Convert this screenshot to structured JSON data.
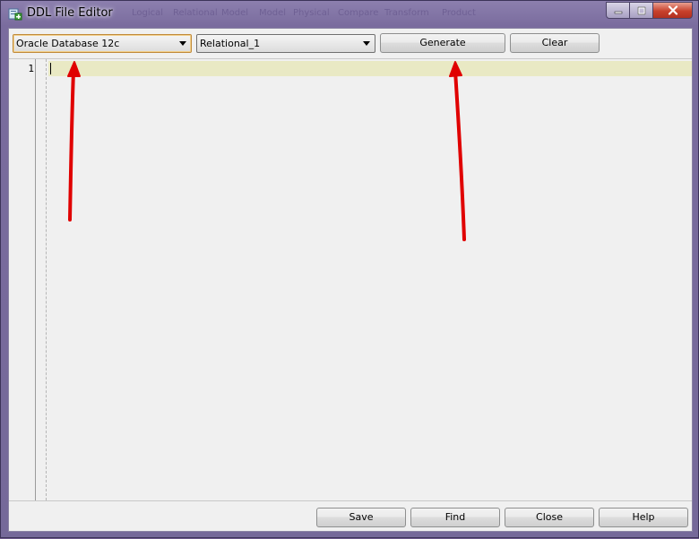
{
  "window": {
    "title": "DDL File Editor",
    "background_menu_ghost": [
      "Logical",
      "Relational",
      "Model",
      "Model",
      "Physical",
      "Compare",
      "Transform",
      "Product"
    ]
  },
  "toolbar": {
    "database_select": "Oracle Database 12c",
    "model_select": "Relational_1",
    "generate_label": "Generate",
    "clear_label": "Clear"
  },
  "editor": {
    "line_numbers": [
      "1"
    ]
  },
  "footer": {
    "save_label": "Save",
    "find_label": "Find",
    "close_label": "Close",
    "help_label": "Help"
  },
  "colors": {
    "current_line_highlight": "#e9e9c4",
    "annotation_arrow": "#e00000",
    "focus_border": "#c08a3a"
  },
  "icons": {
    "app": "ddl-editor-icon",
    "minimize": "minimize-icon",
    "maximize": "maximize-icon",
    "close": "close-icon"
  }
}
